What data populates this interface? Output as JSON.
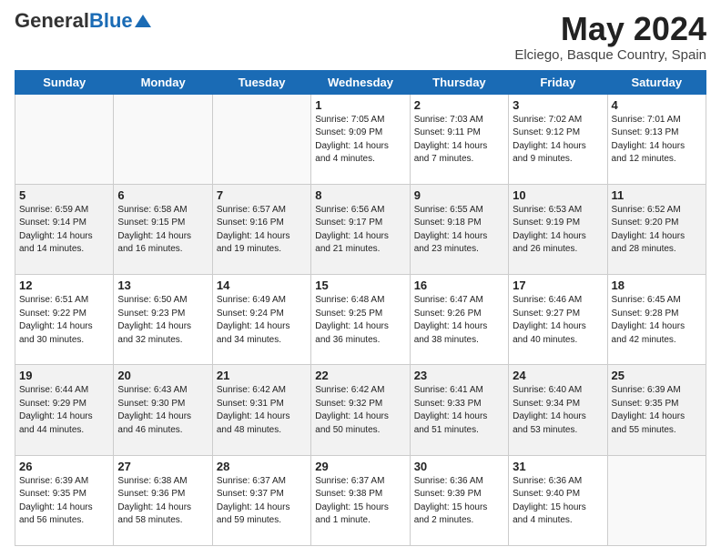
{
  "header": {
    "logo_general": "General",
    "logo_blue": "Blue",
    "main_title": "May 2024",
    "subtitle": "Elciego, Basque Country, Spain"
  },
  "weekdays": [
    "Sunday",
    "Monday",
    "Tuesday",
    "Wednesday",
    "Thursday",
    "Friday",
    "Saturday"
  ],
  "weeks": [
    [
      {
        "day": "",
        "info": ""
      },
      {
        "day": "",
        "info": ""
      },
      {
        "day": "",
        "info": ""
      },
      {
        "day": "1",
        "info": "Sunrise: 7:05 AM\nSunset: 9:09 PM\nDaylight: 14 hours\nand 4 minutes."
      },
      {
        "day": "2",
        "info": "Sunrise: 7:03 AM\nSunset: 9:11 PM\nDaylight: 14 hours\nand 7 minutes."
      },
      {
        "day": "3",
        "info": "Sunrise: 7:02 AM\nSunset: 9:12 PM\nDaylight: 14 hours\nand 9 minutes."
      },
      {
        "day": "4",
        "info": "Sunrise: 7:01 AM\nSunset: 9:13 PM\nDaylight: 14 hours\nand 12 minutes."
      }
    ],
    [
      {
        "day": "5",
        "info": "Sunrise: 6:59 AM\nSunset: 9:14 PM\nDaylight: 14 hours\nand 14 minutes."
      },
      {
        "day": "6",
        "info": "Sunrise: 6:58 AM\nSunset: 9:15 PM\nDaylight: 14 hours\nand 16 minutes."
      },
      {
        "day": "7",
        "info": "Sunrise: 6:57 AM\nSunset: 9:16 PM\nDaylight: 14 hours\nand 19 minutes."
      },
      {
        "day": "8",
        "info": "Sunrise: 6:56 AM\nSunset: 9:17 PM\nDaylight: 14 hours\nand 21 minutes."
      },
      {
        "day": "9",
        "info": "Sunrise: 6:55 AM\nSunset: 9:18 PM\nDaylight: 14 hours\nand 23 minutes."
      },
      {
        "day": "10",
        "info": "Sunrise: 6:53 AM\nSunset: 9:19 PM\nDaylight: 14 hours\nand 26 minutes."
      },
      {
        "day": "11",
        "info": "Sunrise: 6:52 AM\nSunset: 9:20 PM\nDaylight: 14 hours\nand 28 minutes."
      }
    ],
    [
      {
        "day": "12",
        "info": "Sunrise: 6:51 AM\nSunset: 9:22 PM\nDaylight: 14 hours\nand 30 minutes."
      },
      {
        "day": "13",
        "info": "Sunrise: 6:50 AM\nSunset: 9:23 PM\nDaylight: 14 hours\nand 32 minutes."
      },
      {
        "day": "14",
        "info": "Sunrise: 6:49 AM\nSunset: 9:24 PM\nDaylight: 14 hours\nand 34 minutes."
      },
      {
        "day": "15",
        "info": "Sunrise: 6:48 AM\nSunset: 9:25 PM\nDaylight: 14 hours\nand 36 minutes."
      },
      {
        "day": "16",
        "info": "Sunrise: 6:47 AM\nSunset: 9:26 PM\nDaylight: 14 hours\nand 38 minutes."
      },
      {
        "day": "17",
        "info": "Sunrise: 6:46 AM\nSunset: 9:27 PM\nDaylight: 14 hours\nand 40 minutes."
      },
      {
        "day": "18",
        "info": "Sunrise: 6:45 AM\nSunset: 9:28 PM\nDaylight: 14 hours\nand 42 minutes."
      }
    ],
    [
      {
        "day": "19",
        "info": "Sunrise: 6:44 AM\nSunset: 9:29 PM\nDaylight: 14 hours\nand 44 minutes."
      },
      {
        "day": "20",
        "info": "Sunrise: 6:43 AM\nSunset: 9:30 PM\nDaylight: 14 hours\nand 46 minutes."
      },
      {
        "day": "21",
        "info": "Sunrise: 6:42 AM\nSunset: 9:31 PM\nDaylight: 14 hours\nand 48 minutes."
      },
      {
        "day": "22",
        "info": "Sunrise: 6:42 AM\nSunset: 9:32 PM\nDaylight: 14 hours\nand 50 minutes."
      },
      {
        "day": "23",
        "info": "Sunrise: 6:41 AM\nSunset: 9:33 PM\nDaylight: 14 hours\nand 51 minutes."
      },
      {
        "day": "24",
        "info": "Sunrise: 6:40 AM\nSunset: 9:34 PM\nDaylight: 14 hours\nand 53 minutes."
      },
      {
        "day": "25",
        "info": "Sunrise: 6:39 AM\nSunset: 9:35 PM\nDaylight: 14 hours\nand 55 minutes."
      }
    ],
    [
      {
        "day": "26",
        "info": "Sunrise: 6:39 AM\nSunset: 9:35 PM\nDaylight: 14 hours\nand 56 minutes."
      },
      {
        "day": "27",
        "info": "Sunrise: 6:38 AM\nSunset: 9:36 PM\nDaylight: 14 hours\nand 58 minutes."
      },
      {
        "day": "28",
        "info": "Sunrise: 6:37 AM\nSunset: 9:37 PM\nDaylight: 14 hours\nand 59 minutes."
      },
      {
        "day": "29",
        "info": "Sunrise: 6:37 AM\nSunset: 9:38 PM\nDaylight: 15 hours\nand 1 minute."
      },
      {
        "day": "30",
        "info": "Sunrise: 6:36 AM\nSunset: 9:39 PM\nDaylight: 15 hours\nand 2 minutes."
      },
      {
        "day": "31",
        "info": "Sunrise: 6:36 AM\nSunset: 9:40 PM\nDaylight: 15 hours\nand 4 minutes."
      },
      {
        "day": "",
        "info": ""
      }
    ]
  ]
}
